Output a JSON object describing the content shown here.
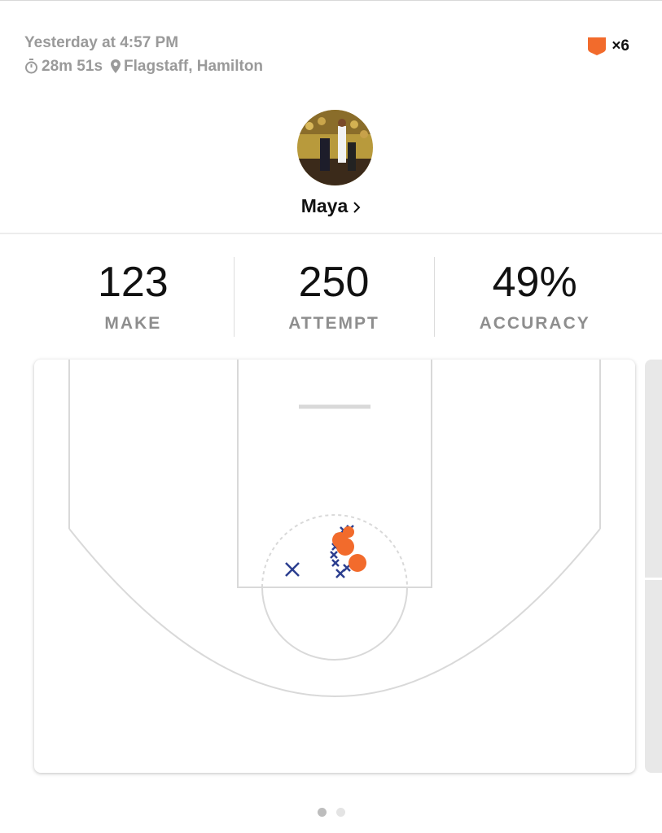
{
  "header": {
    "timestamp": "Yesterday at 4:57 PM",
    "duration": "28m 51s",
    "location": "Flagstaff, Hamilton",
    "icons": {
      "duration": "stopwatch-icon",
      "location": "location-pin-icon"
    }
  },
  "badge": {
    "icon": "shield-badge-icon",
    "count": "×6",
    "color": "#F26B2C"
  },
  "player": {
    "name": "Maya",
    "icon": "chevron-right-icon"
  },
  "stats": [
    {
      "value": "123",
      "label": "MAKE"
    },
    {
      "value": "250",
      "label": "ATTEMPT"
    },
    {
      "value": "49%",
      "label": "ACCURACY"
    }
  ],
  "shot_chart": {
    "colors": {
      "make": "#F26B2C",
      "miss": "#2B3E8F",
      "lines": "#d6d6d6"
    },
    "legend": {
      "make_icon": "orange-dot",
      "miss_icon": "blue-x"
    }
  },
  "pagination": {
    "pages": 2,
    "active": 0,
    "active_color": "#bdbdbd",
    "inactive_color": "#e4e4e4"
  }
}
